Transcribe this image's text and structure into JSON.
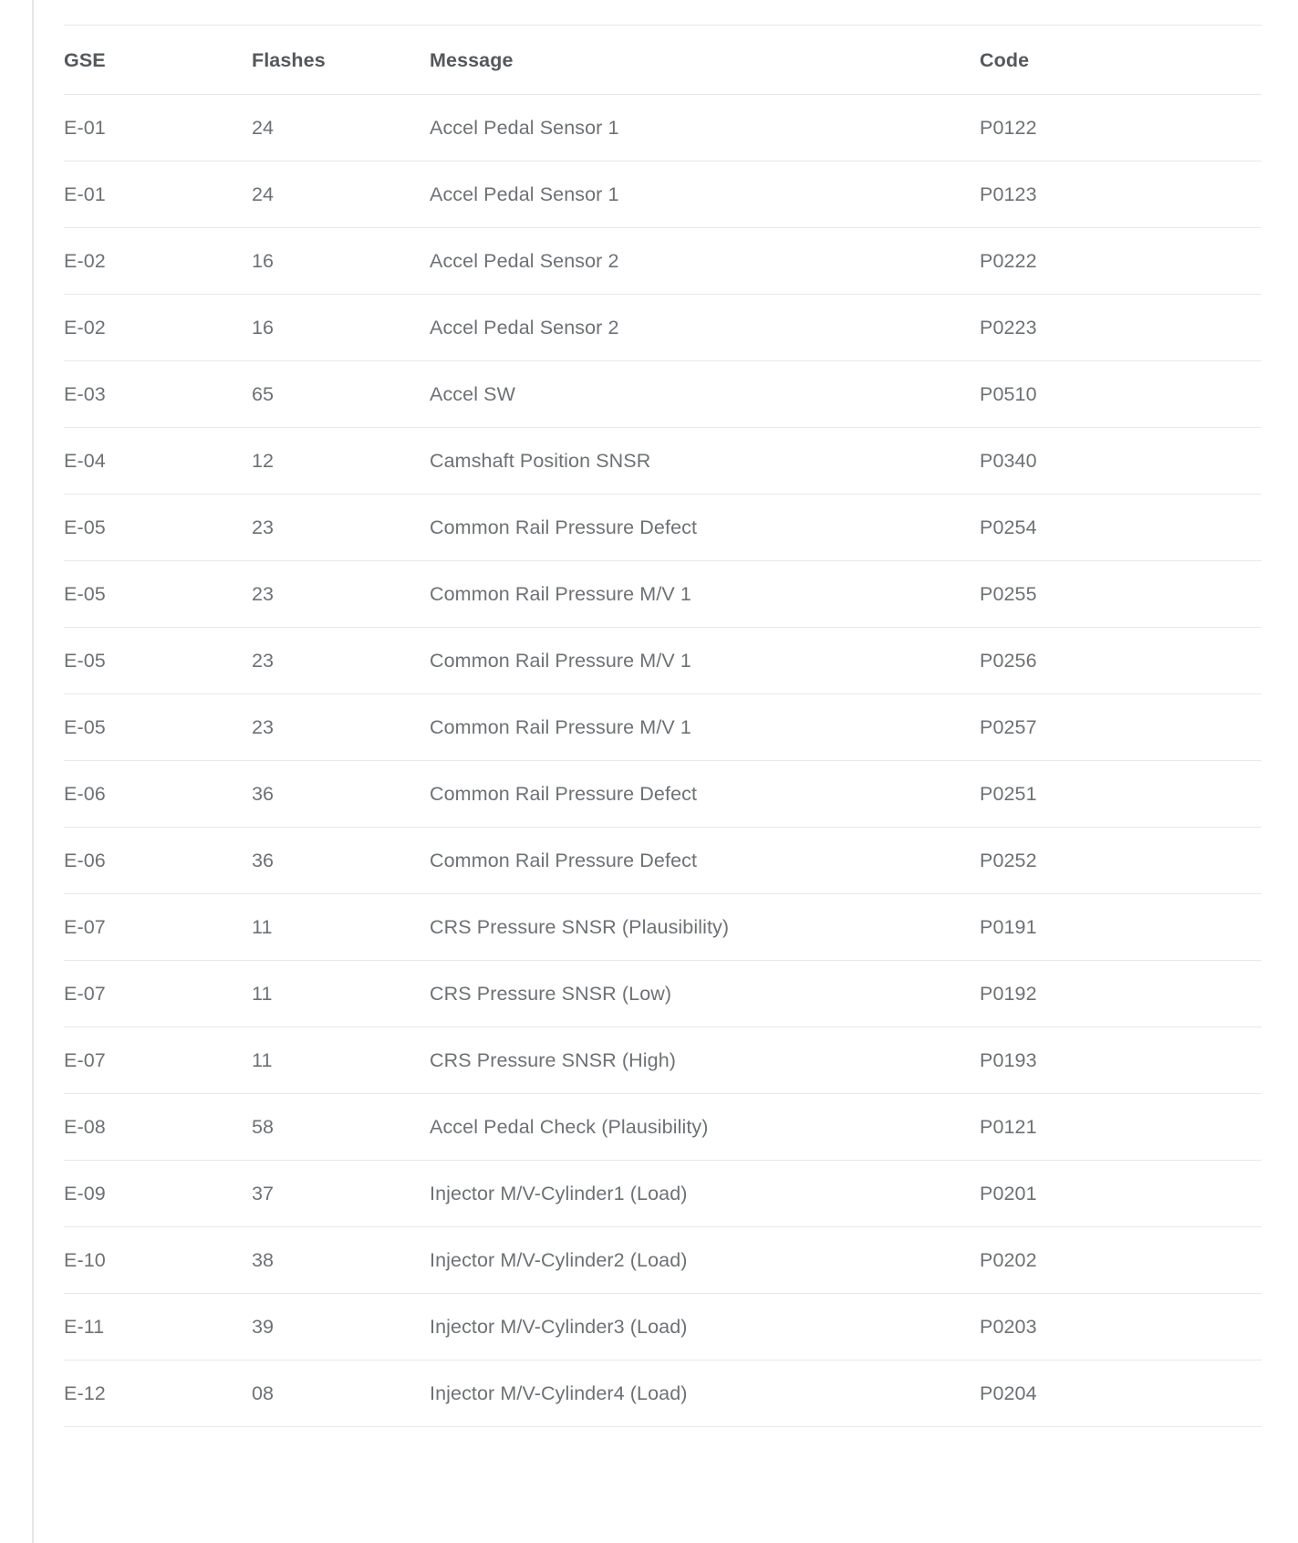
{
  "table": {
    "columns": [
      {
        "key": "gse",
        "label": "GSE"
      },
      {
        "key": "flashes",
        "label": "Flashes"
      },
      {
        "key": "message",
        "label": "Message"
      },
      {
        "key": "code",
        "label": "Code"
      }
    ],
    "rows": [
      {
        "gse": "E-01",
        "flashes": "24",
        "message": "Accel Pedal Sensor 1",
        "code": "P0122"
      },
      {
        "gse": "E-01",
        "flashes": "24",
        "message": "Accel Pedal Sensor 1",
        "code": "P0123"
      },
      {
        "gse": "E-02",
        "flashes": "16",
        "message": "Accel Pedal Sensor 2",
        "code": "P0222"
      },
      {
        "gse": "E-02",
        "flashes": "16",
        "message": "Accel Pedal Sensor 2",
        "code": "P0223"
      },
      {
        "gse": "E-03",
        "flashes": "65",
        "message": "Accel SW",
        "code": "P0510"
      },
      {
        "gse": "E-04",
        "flashes": "12",
        "message": "Camshaft Position SNSR",
        "code": "P0340"
      },
      {
        "gse": "E-05",
        "flashes": "23",
        "message": "Common Rail Pressure Defect",
        "code": "P0254"
      },
      {
        "gse": "E-05",
        "flashes": "23",
        "message": "Common Rail Pressure M/V 1",
        "code": "P0255"
      },
      {
        "gse": "E-05",
        "flashes": "23",
        "message": "Common Rail Pressure M/V 1",
        "code": "P0256"
      },
      {
        "gse": "E-05",
        "flashes": "23",
        "message": "Common Rail Pressure M/V 1",
        "code": "P0257"
      },
      {
        "gse": "E-06",
        "flashes": "36",
        "message": "Common Rail Pressure Defect",
        "code": "P0251"
      },
      {
        "gse": "E-06",
        "flashes": "36",
        "message": "Common Rail Pressure Defect",
        "code": "P0252"
      },
      {
        "gse": "E-07",
        "flashes": "11",
        "message": "CRS Pressure SNSR (Plausibility)",
        "code": "P0191"
      },
      {
        "gse": "E-07",
        "flashes": "11",
        "message": "CRS Pressure SNSR (Low)",
        "code": "P0192"
      },
      {
        "gse": "E-07",
        "flashes": "11",
        "message": "CRS Pressure SNSR (High)",
        "code": "P0193"
      },
      {
        "gse": "E-08",
        "flashes": "58",
        "message": "Accel Pedal Check (Plausibility)",
        "code": "P0121"
      },
      {
        "gse": "E-09",
        "flashes": "37",
        "message": "Injector M/V-Cylinder1 (Load)",
        "code": "P0201"
      },
      {
        "gse": "E-10",
        "flashes": "38",
        "message": "Injector M/V-Cylinder2 (Load)",
        "code": "P0202"
      },
      {
        "gse": "E-11",
        "flashes": "39",
        "message": "Injector M/V-Cylinder3 (Load)",
        "code": "P0203"
      },
      {
        "gse": "E-12",
        "flashes": "08",
        "message": "Injector M/V-Cylinder4 (Load)",
        "code": "P0204"
      }
    ]
  },
  "colors": {
    "header_text": "#55585b",
    "body_text": "#6e7173",
    "rule": "#e8e8e8",
    "left_rule": "#e6e6e6",
    "background": "#ffffff"
  }
}
